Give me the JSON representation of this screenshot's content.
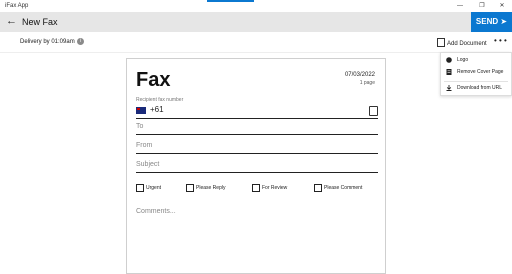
{
  "window": {
    "title": "iFax App",
    "minimize_glyph": "—",
    "restore_glyph": "❐",
    "close_glyph": "✕"
  },
  "header": {
    "back_glyph": "←",
    "page_title": "New Fax",
    "send_label": "SEND ➤"
  },
  "toolbar": {
    "delivery_text": "Delivery by 01:09am",
    "info_glyph": "i",
    "add_document_label": "Add Document",
    "more_glyph": "• • •"
  },
  "menu": {
    "items": [
      {
        "label": "Logo",
        "icon": "logo-icon"
      },
      {
        "label": "Remove Cover Page",
        "icon": "document-icon"
      },
      {
        "label": "Download from URL",
        "icon": "download-icon"
      }
    ]
  },
  "fax": {
    "title": "Fax",
    "date": "07/03/2022",
    "pages": "1 page",
    "recipient_label": "Recipient fax number",
    "country_code": "+61",
    "to_placeholder": "To",
    "from_placeholder": "From",
    "subject_placeholder": "Subject",
    "comments_placeholder": "Comments...",
    "checkboxes": [
      {
        "label": "Urgent",
        "checked": false
      },
      {
        "label": "Please Reply",
        "checked": false
      },
      {
        "label": "For Review",
        "checked": false
      },
      {
        "label": "Please Comment",
        "checked": false
      }
    ]
  },
  "colors": {
    "accent": "#0b78d0",
    "header_bg": "#e6e6e6"
  }
}
